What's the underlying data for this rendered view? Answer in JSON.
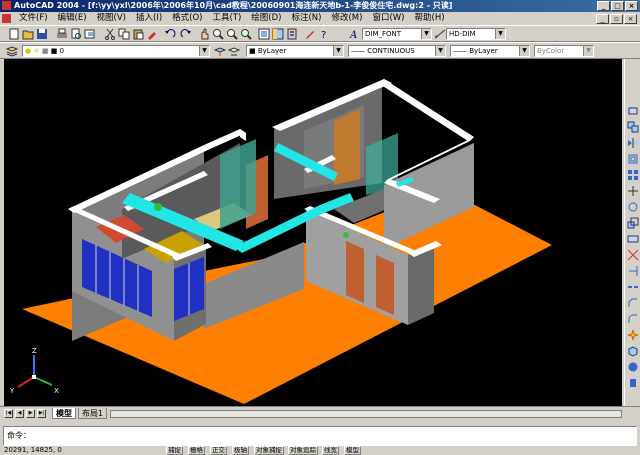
{
  "title": "AutoCAD 2004 - [f:\\yy\\yxl\\2006年\\2006年10月\\cad教程\\20060901海连新天地b-1-李俊俊住宅.dwg:2 - 只读]",
  "menu": [
    "文件(F)",
    "编辑(E)",
    "视图(V)",
    "插入(I)",
    "格式(O)",
    "工具(T)",
    "绘图(D)",
    "标注(N)",
    "修改(M)",
    "窗口(W)",
    "帮助(H)"
  ],
  "toolbar": {
    "textstyle": "DIM_FONT",
    "dimstyle": "HD-DIM",
    "layer": "0",
    "color": "ByLayer",
    "linetype": "CONTINUOUS",
    "lineweight": "ByLayer",
    "plotstyle": "ByColor"
  },
  "tabs": [
    "模型",
    "布局1"
  ],
  "command_prompt": "命令：",
  "coords": "20291, 14825, 0",
  "status_buttons": [
    "捕捉",
    "栅格",
    "正交",
    "极轴",
    "对象捕捉",
    "对象追踪",
    "线宽",
    "模型"
  ],
  "ucs": {
    "x": "X",
    "y": "Y",
    "z": "Z"
  },
  "colors": {
    "canvas": "#000000",
    "floor": "#ff8000",
    "wall_top": "#ffffff",
    "wall_side": "#8a8a8a",
    "beam": "#22e5e5",
    "glass": "#2030c0",
    "wood": "#d87a40",
    "accent": "#0a246a"
  }
}
